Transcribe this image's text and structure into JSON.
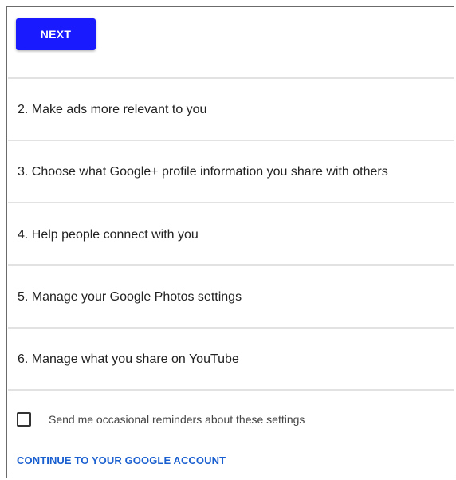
{
  "header": {
    "next_label": "NEXT"
  },
  "sections": [
    {
      "label": "2. Make ads more relevant to you"
    },
    {
      "label": "3. Choose what Google+ profile information you share with others"
    },
    {
      "label": "4. Help people connect with you"
    },
    {
      "label": "5. Manage your Google Photos settings"
    },
    {
      "label": "6. Manage what you share on YouTube"
    }
  ],
  "reminders": {
    "checked": false,
    "label": "Send me occasional reminders about these settings"
  },
  "footer": {
    "continue_label": "CONTINUE TO YOUR GOOGLE ACCOUNT"
  },
  "colors": {
    "button_bg": "#1a1aff",
    "link": "#1a5fd0"
  }
}
